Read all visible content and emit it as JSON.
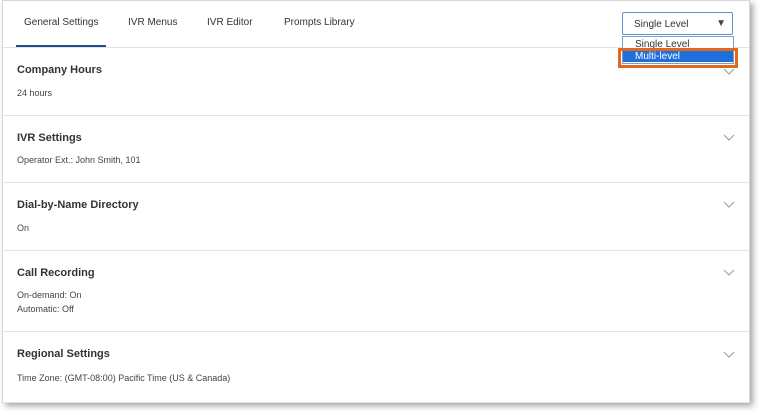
{
  "tabs": [
    {
      "label": "General Settings",
      "active": true
    },
    {
      "label": "IVR Menus",
      "active": false
    },
    {
      "label": "IVR Editor",
      "active": false
    },
    {
      "label": "Prompts Library",
      "active": false
    }
  ],
  "level_select": {
    "value": "Single Level",
    "arrow_icon": "triangle-down-icon",
    "options": [
      "Single Level",
      "Multi-level"
    ],
    "highlighted_option": "Multi-level"
  },
  "colors": {
    "accent": "#1f4e8c",
    "selected_option": "#1e6fd9",
    "callout": "#e0691d"
  },
  "sections": [
    {
      "title": "Company Hours",
      "lines": [
        "24 hours"
      ],
      "icon": "chevron-down-icon"
    },
    {
      "title": "IVR Settings",
      "lines": [
        "Operator Ext.: John Smith, 101"
      ],
      "icon": "chevron-down-icon"
    },
    {
      "title": "Dial-by-Name Directory",
      "lines": [
        "On"
      ],
      "icon": "chevron-down-icon"
    },
    {
      "title": "Call Recording",
      "lines": [
        "On-demand: On",
        "Automatic: Off"
      ],
      "icon": "chevron-down-icon"
    },
    {
      "title": "Regional Settings",
      "lines": [
        "Time Zone: (GMT-08:00) Pacific Time (US & Canada)"
      ],
      "icon": "chevron-down-icon"
    }
  ]
}
